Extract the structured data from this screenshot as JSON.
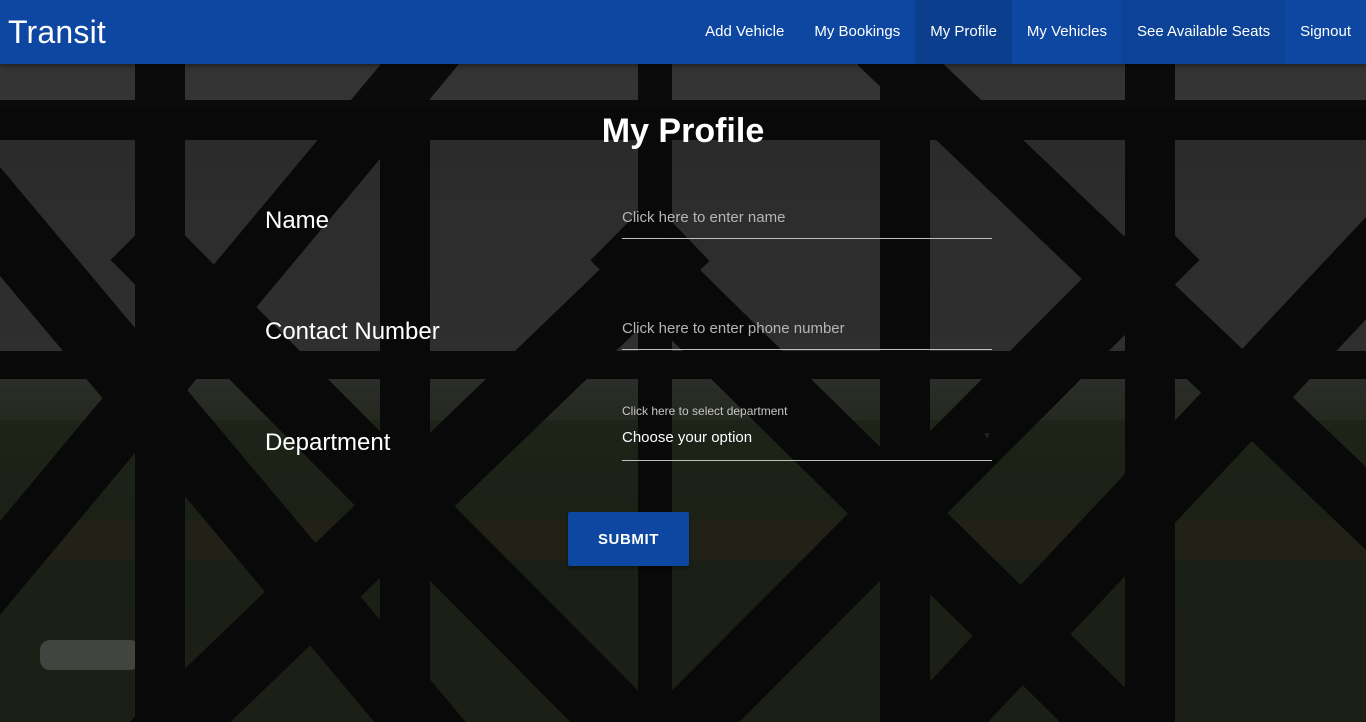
{
  "navbar": {
    "brand": "Transit",
    "links": [
      {
        "label": "Add Vehicle"
      },
      {
        "label": "My Bookings"
      },
      {
        "label": "My Profile"
      },
      {
        "label": "My Vehicles"
      },
      {
        "label": "See Available Seats"
      },
      {
        "label": "Signout"
      }
    ],
    "active": "My Profile",
    "background_color": "#0d47a1"
  },
  "form": {
    "title": "My Profile",
    "name": {
      "label": "Name",
      "placeholder": "Click here to enter name",
      "value": ""
    },
    "contact": {
      "label": "Contact Number",
      "placeholder": "Click here to enter phone number",
      "value": ""
    },
    "department": {
      "label": "Department",
      "caption": "Click here to select department",
      "selected": "Choose your option"
    },
    "submit_label": "SUBMIT",
    "accent_color": "#0d47a1"
  }
}
